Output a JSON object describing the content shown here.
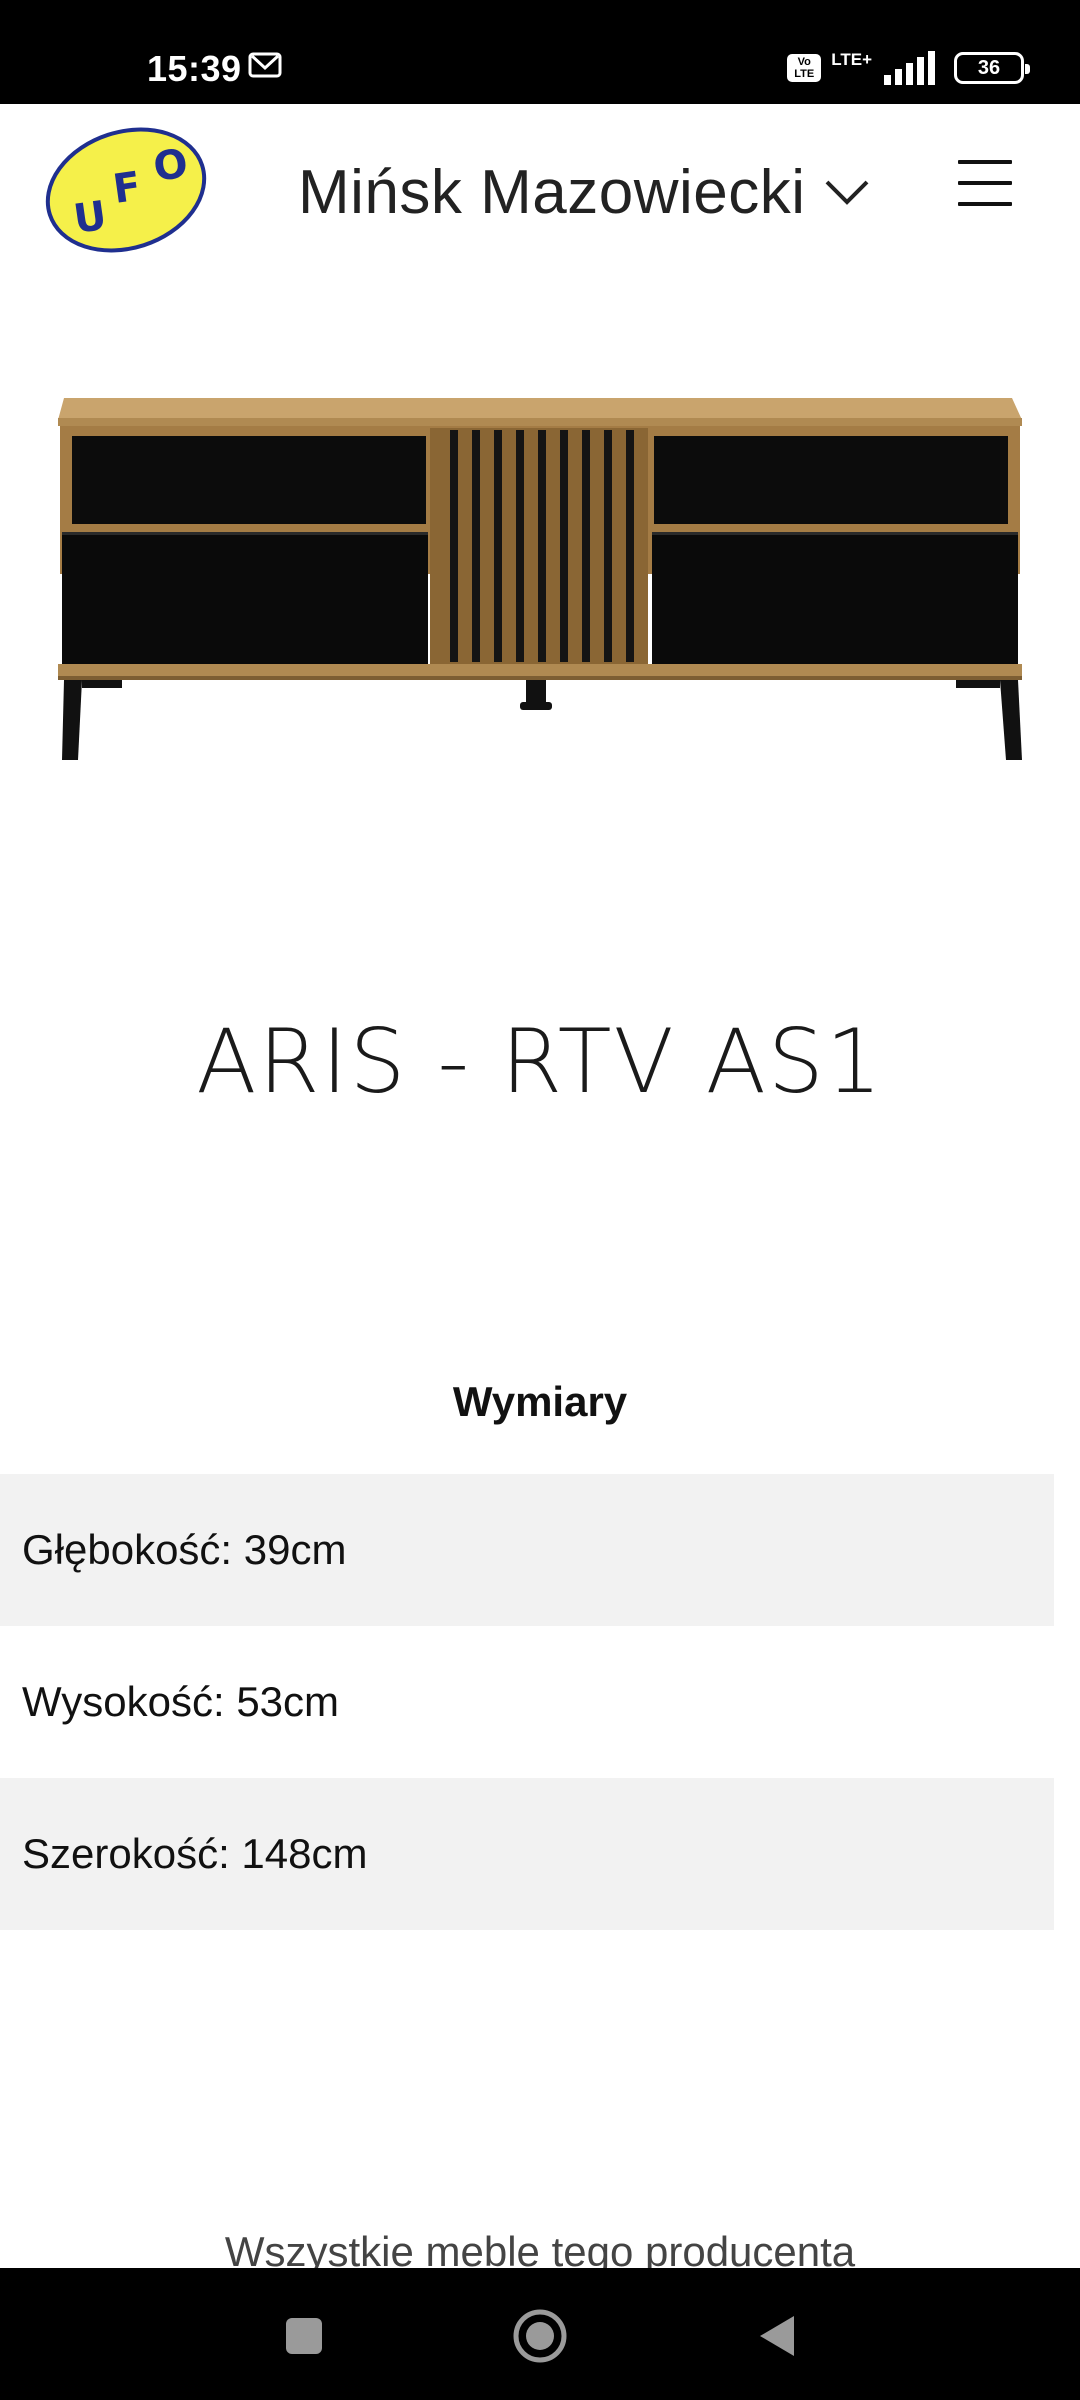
{
  "status_bar": {
    "time": "15:39",
    "volte": "Vo LTE",
    "network": "LTE+",
    "battery": "36",
    "icons": [
      "mail-icon",
      "signal-icon",
      "battery-icon"
    ]
  },
  "header": {
    "logo_letters": [
      "U",
      "F",
      "O"
    ],
    "location": "Mińsk Mazowiecki",
    "icons": [
      "chevron-down-icon",
      "hamburger-menu-icon"
    ]
  },
  "product": {
    "title": "ARIS - RTV AS1",
    "image": "tv-cabinet-product-image"
  },
  "dimensions": {
    "heading": "Wymiary",
    "rows": [
      "Głębokość: 39cm",
      "Wysokość: 53cm",
      "Szerokość: 148cm"
    ]
  },
  "footer": {
    "producer_link": "Wszystkie meble tego producenta"
  },
  "colors": {
    "logo_yellow": "#f5f04a",
    "logo_blue": "#1f2f8f",
    "row_shade": "#f2f2f2"
  }
}
